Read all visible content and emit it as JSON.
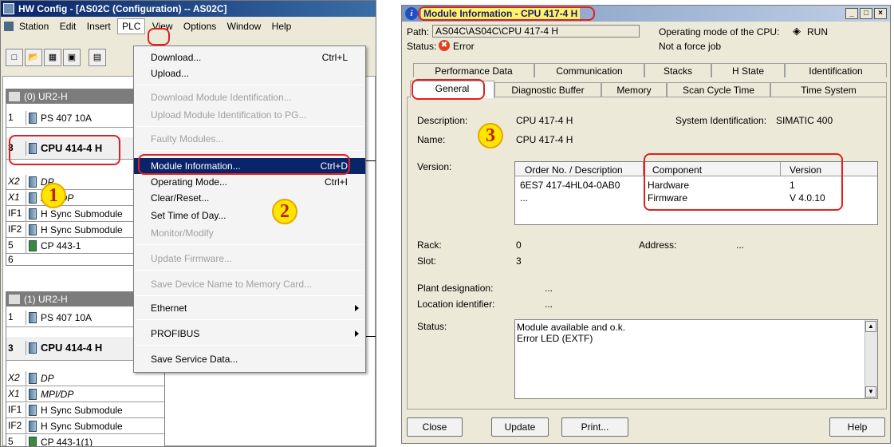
{
  "hw": {
    "title": "HW Config - [AS02C (Configuration) -- AS02C]",
    "menubar": [
      "Station",
      "Edit",
      "Insert",
      "PLC",
      "View",
      "Options",
      "Window",
      "Help"
    ],
    "rack1": {
      "title": "(0) UR2-H",
      "rows": [
        {
          "slot": "1",
          "module": "PS 407 10A"
        },
        {
          "slot": "3",
          "module": "CPU 414-4 H"
        },
        {
          "slot": "X2",
          "module": "DP"
        },
        {
          "slot": "X1",
          "module": "MPI/DP"
        },
        {
          "slot": "IF1",
          "module": "H Sync Submodule"
        },
        {
          "slot": "IF2",
          "module": "H Sync Submodule"
        },
        {
          "slot": "5",
          "module": "CP 443-1"
        },
        {
          "slot": "6",
          "module": ""
        }
      ]
    },
    "rack2": {
      "title": "(1) UR2-H",
      "rows": [
        {
          "slot": "1",
          "module": "PS 407 10A"
        },
        {
          "slot": "3",
          "module": "CPU 414-4 H"
        },
        {
          "slot": "X2",
          "module": "DP"
        },
        {
          "slot": "X1",
          "module": "MPI/DP"
        },
        {
          "slot": "IF1",
          "module": "H Sync Submodule"
        },
        {
          "slot": "IF2",
          "module": "H Sync Submodule"
        },
        {
          "slot": "5",
          "module": "CP 443-1(1)"
        }
      ]
    }
  },
  "plc_menu": {
    "items": [
      {
        "label": "Download...",
        "shortcut": "Ctrl+L"
      },
      {
        "label": "Upload..."
      },
      {
        "label": "Download Module Identification..."
      },
      {
        "label": "Upload Module Identification to PG..."
      },
      {
        "label": "Faulty Modules..."
      },
      {
        "label": "Module Information...",
        "shortcut": "Ctrl+D"
      },
      {
        "label": "Operating Mode...",
        "shortcut": "Ctrl+I"
      },
      {
        "label": "Clear/Reset..."
      },
      {
        "label": "Set Time of Day..."
      },
      {
        "label": "Monitor/Modify"
      },
      {
        "label": "Update Firmware..."
      },
      {
        "label": "Save Device Name to Memory Card..."
      },
      {
        "label": "Ethernet"
      },
      {
        "label": "PROFIBUS"
      },
      {
        "label": "Save Service Data..."
      }
    ]
  },
  "callouts": [
    "1",
    "2",
    "3"
  ],
  "modinfo": {
    "title": "Module Information - CPU 417-4 H",
    "path_label": "Path:",
    "path": "AS04C\\AS04C\\CPU 417-4 H",
    "opmode_label": "Operating mode of the CPU:",
    "opmode": "RUN",
    "status_label": "Status:",
    "status": "Error",
    "force": "Not a force job",
    "tabs_back": [
      "Performance Data",
      "Communication",
      "Stacks",
      "H State",
      "Identification"
    ],
    "tabs_front": [
      "General",
      "Diagnostic Buffer",
      "Memory",
      "Scan Cycle Time",
      "Time System"
    ],
    "description_label": "Description:",
    "description": "CPU 417-4 H",
    "sysid_label": "System Identification:",
    "sysid": "SIMATIC 400",
    "name_label": "Name:",
    "name": "CPU 417-4 H",
    "version_label": "Version:",
    "version_table": {
      "headers": [
        "Order No. / Description",
        "Component",
        "Version"
      ],
      "order_no": "6ES7 417-4HL04-0AB0",
      "order_more": "...",
      "rows": [
        {
          "component": "Hardware",
          "version": "1"
        },
        {
          "component": "Firmware",
          "version": "V 4.0.10"
        }
      ]
    },
    "rack_label": "Rack:",
    "rack": "0",
    "address_label": "Address:",
    "address": "...",
    "slot_label": "Slot:",
    "slot": "3",
    "plant_label": "Plant designation:",
    "plant": "...",
    "location_label": "Location identifier:",
    "location": "...",
    "status2_label": "Status:",
    "status_lines": [
      "Module available and o.k.",
      "Error LED (EXTF)"
    ],
    "buttons": {
      "close": "Close",
      "update": "Update",
      "print": "Print...",
      "help": "Help"
    }
  }
}
